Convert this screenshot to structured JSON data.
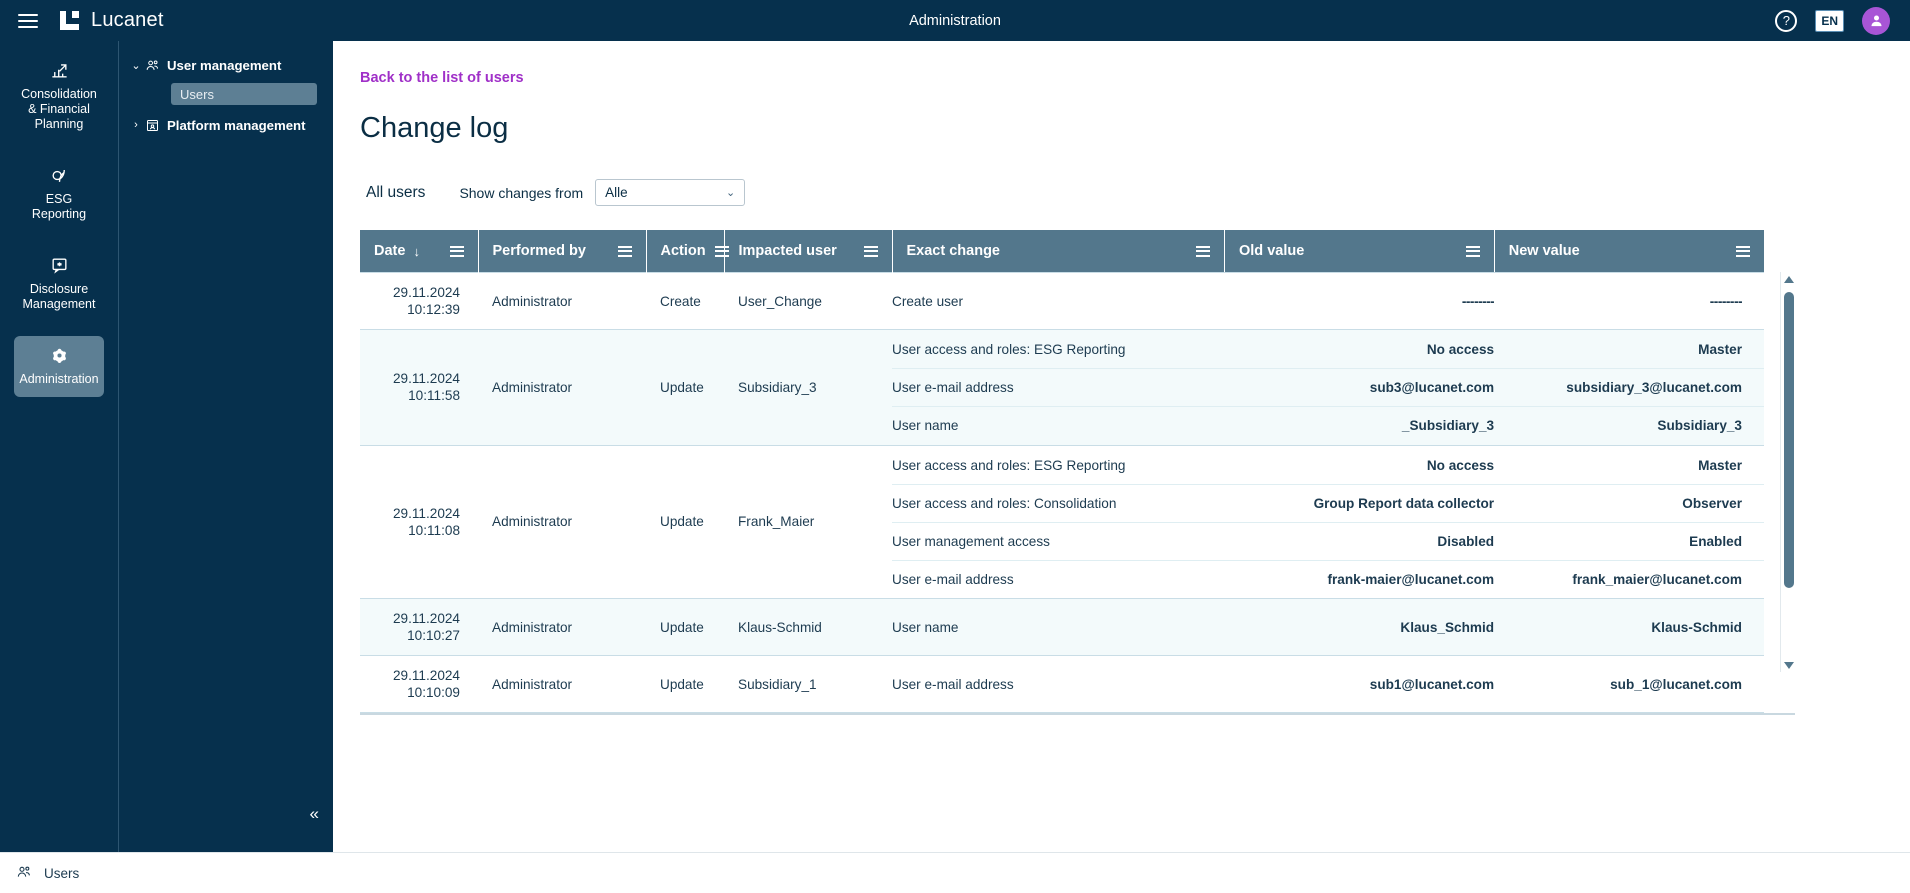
{
  "topbar": {
    "title": "Administration",
    "brand": "Lucanet",
    "menu_icon": "hamburger-icon",
    "help_icon": "help-icon",
    "help_glyph": "?",
    "language": "EN",
    "avatar_icon": "user-avatar"
  },
  "rail": {
    "items": [
      {
        "label": "Consolidation\n& Financial\nPlanning",
        "line1": "Consolidation",
        "line2": "& Financial",
        "line3": "Planning",
        "icon": "bar-chart-icon",
        "active": false
      },
      {
        "label": "ESG Reporting",
        "line1": "ESG Reporting",
        "line2": "",
        "line3": "",
        "icon": "leaf-icon",
        "active": false
      },
      {
        "label": "Disclosure Management",
        "line1": "Disclosure",
        "line2": "Management",
        "line3": "",
        "icon": "document-star-icon",
        "active": false
      },
      {
        "label": "Administration",
        "line1": "Administration",
        "line2": "",
        "line3": "",
        "icon": "gear-icon",
        "active": true
      }
    ]
  },
  "tree": {
    "nodes": [
      {
        "label": "User management",
        "icon": "users-icon",
        "expanded": true,
        "chevron": "⌄"
      },
      {
        "label": "Platform management",
        "icon": "platform-icon",
        "expanded": false,
        "chevron": "›"
      }
    ],
    "child": {
      "label": "Users",
      "active": true
    },
    "collapse_icon": "chevron-double-left-icon",
    "collapse_glyph": "«"
  },
  "main": {
    "back_link": "Back to the list of users",
    "page_title": "Change log",
    "tab_all_users": "All users",
    "filter_label": "Show changes from",
    "filter_value": "Alle",
    "filter_caret": "⌄"
  },
  "table": {
    "columns": [
      {
        "label": "Date",
        "sorted": true,
        "sort_glyph": "↓",
        "menu": true
      },
      {
        "label": "Performed by",
        "sorted": false,
        "menu": true
      },
      {
        "label": "Action",
        "sorted": false,
        "menu": true
      },
      {
        "label": "Impacted user",
        "sorted": false,
        "menu": true
      },
      {
        "label": "Exact change",
        "sorted": false,
        "menu": true
      },
      {
        "label": "Old value",
        "sorted": false,
        "menu": true
      },
      {
        "label": "New value",
        "sorted": false,
        "menu": true
      }
    ],
    "empty_value": "--------",
    "rows": [
      {
        "date_day": "29.11.2024",
        "date_time": "10:12:39",
        "performed_by": "Administrator",
        "action": "Create",
        "impacted_user": "User_Change",
        "changes": [
          {
            "change": "Create user",
            "old": "--------",
            "new": "--------",
            "is_empty": true
          }
        ]
      },
      {
        "date_day": "29.11.2024",
        "date_time": "10:11:58",
        "performed_by": "Administrator",
        "action": "Update",
        "impacted_user": "Subsidiary_3",
        "changes": [
          {
            "change": "User access and roles: ESG Reporting",
            "old": "No access",
            "new": "Master",
            "is_empty": false
          },
          {
            "change": "User e-mail address",
            "old": "sub3@lucanet.com",
            "new": "subsidiary_3@lucanet.com",
            "is_empty": false
          },
          {
            "change": "User name",
            "old": "_Subsidiary_3",
            "new": "Subsidiary_3",
            "is_empty": false
          }
        ]
      },
      {
        "date_day": "29.11.2024",
        "date_time": "10:11:08",
        "performed_by": "Administrator",
        "action": "Update",
        "impacted_user": "Frank_Maier",
        "changes": [
          {
            "change": "User access and roles: ESG Reporting",
            "old": "No access",
            "new": "Master",
            "is_empty": false
          },
          {
            "change": "User access and roles: Consolidation",
            "old": "Group Report data collector",
            "new": "Observer",
            "is_empty": false
          },
          {
            "change": "User management access",
            "old": "Disabled",
            "new": "Enabled",
            "is_empty": false
          },
          {
            "change": "User e-mail address",
            "old": "frank-maier@lucanet.com",
            "new": "frank_maier@lucanet.com",
            "is_empty": false
          }
        ]
      },
      {
        "date_day": "29.11.2024",
        "date_time": "10:10:27",
        "performed_by": "Administrator",
        "action": "Update",
        "impacted_user": "Klaus-Schmid",
        "changes": [
          {
            "change": "User name",
            "old": "Klaus_Schmid",
            "new": "Klaus-Schmid",
            "is_empty": false
          }
        ]
      },
      {
        "date_day": "29.11.2024",
        "date_time": "10:10:09",
        "performed_by": "Administrator",
        "action": "Update",
        "impacted_user": "Subsidiary_1",
        "changes": [
          {
            "change": "User e-mail address",
            "old": "sub1@lucanet.com",
            "new": "sub_1@lucanet.com",
            "is_empty": false
          }
        ]
      }
    ]
  },
  "statusbar": {
    "label": "Users",
    "icon": "users-icon"
  },
  "colors": {
    "navy": "#06304d",
    "accent_purple": "#a030c8",
    "header_slate": "#53778c",
    "row_alt": "#f3fafb",
    "selected_nav": "#5d7f94"
  }
}
